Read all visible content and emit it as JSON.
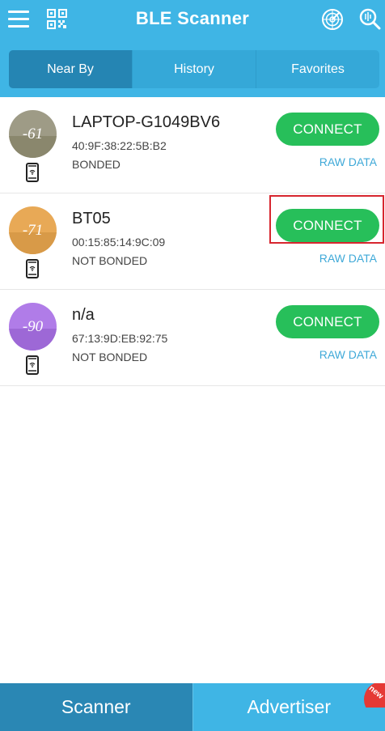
{
  "app": {
    "title": "BLE Scanner"
  },
  "colors": {
    "primary": "#3fb5e5",
    "tab_active": "#2585b3",
    "connect_green": "#27bf5a",
    "raw_link": "#3fa9d8",
    "highlight_red": "#d7262f"
  },
  "header": {
    "icons": [
      "menu-icon",
      "qr-code-icon",
      "radar-icon",
      "search-icon"
    ]
  },
  "tabs": [
    {
      "label": "Near By",
      "active": true
    },
    {
      "label": "History",
      "active": false
    },
    {
      "label": "Favorites",
      "active": false
    }
  ],
  "devices": [
    {
      "rssi": "-61",
      "name": "LAPTOP-G1049BV6",
      "mac": "40:9F:38:22:5B:B2",
      "bond": "BONDED",
      "connect_label": "CONNECT",
      "raw_label": "RAW DATA",
      "color_top": "#9e9b86",
      "color_bottom": "#8a876d"
    },
    {
      "rssi": "-71",
      "name": "BT05",
      "mac": "00:15:85:14:9C:09",
      "bond": "NOT BONDED",
      "connect_label": "CONNECT",
      "raw_label": "RAW DATA",
      "color_top": "#e8a956",
      "color_bottom": "#d89a48",
      "highlighted": true
    },
    {
      "rssi": "-90",
      "name": "n/a",
      "mac": "67:13:9D:EB:92:75",
      "bond": "NOT BONDED",
      "connect_label": "CONNECT",
      "raw_label": "RAW DATA",
      "color_top": "#b07ce8",
      "color_bottom": "#9d68d6"
    }
  ],
  "bottom_nav": {
    "scanner_label": "Scanner",
    "advertiser_label": "Advertiser",
    "badge": "new"
  }
}
